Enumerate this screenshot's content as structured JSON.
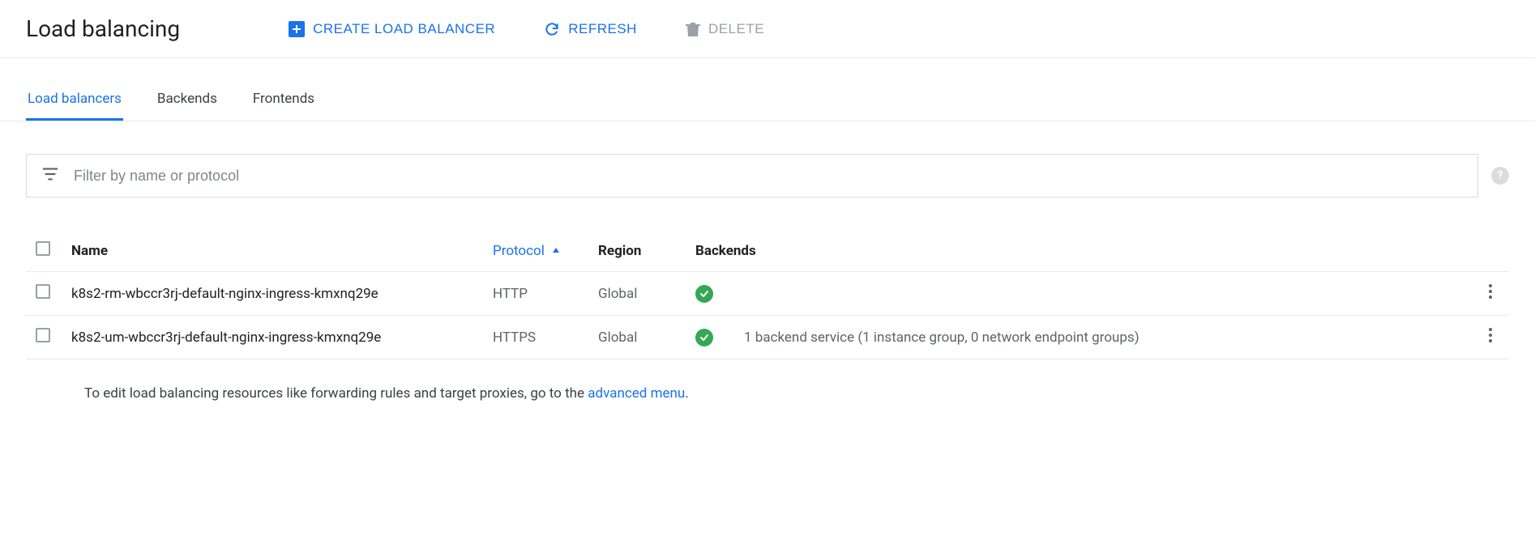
{
  "header": {
    "title": "Load balancing",
    "create_label": "CREATE LOAD BALANCER",
    "refresh_label": "REFRESH",
    "delete_label": "DELETE"
  },
  "tabs": [
    {
      "label": "Load balancers",
      "active": true
    },
    {
      "label": "Backends",
      "active": false
    },
    {
      "label": "Frontends",
      "active": false
    }
  ],
  "filter": {
    "placeholder": "Filter by name or protocol"
  },
  "table": {
    "columns": {
      "name": "Name",
      "protocol": "Protocol",
      "region": "Region",
      "backends": "Backends"
    },
    "sort": {
      "column": "protocol",
      "direction": "asc"
    },
    "rows": [
      {
        "name": "k8s2-rm-wbccr3rj-default-nginx-ingress-kmxnq29e",
        "protocol": "HTTP",
        "region": "Global",
        "status": "ok",
        "backends_text": ""
      },
      {
        "name": "k8s2-um-wbccr3rj-default-nginx-ingress-kmxnq29e",
        "protocol": "HTTPS",
        "region": "Global",
        "status": "ok",
        "backends_text": "1 backend service (1 instance group, 0 network endpoint groups)"
      }
    ]
  },
  "footnote": {
    "text": "To edit load balancing resources like forwarding rules and target proxies, go to the ",
    "link_text": "advanced menu",
    "suffix": "."
  }
}
